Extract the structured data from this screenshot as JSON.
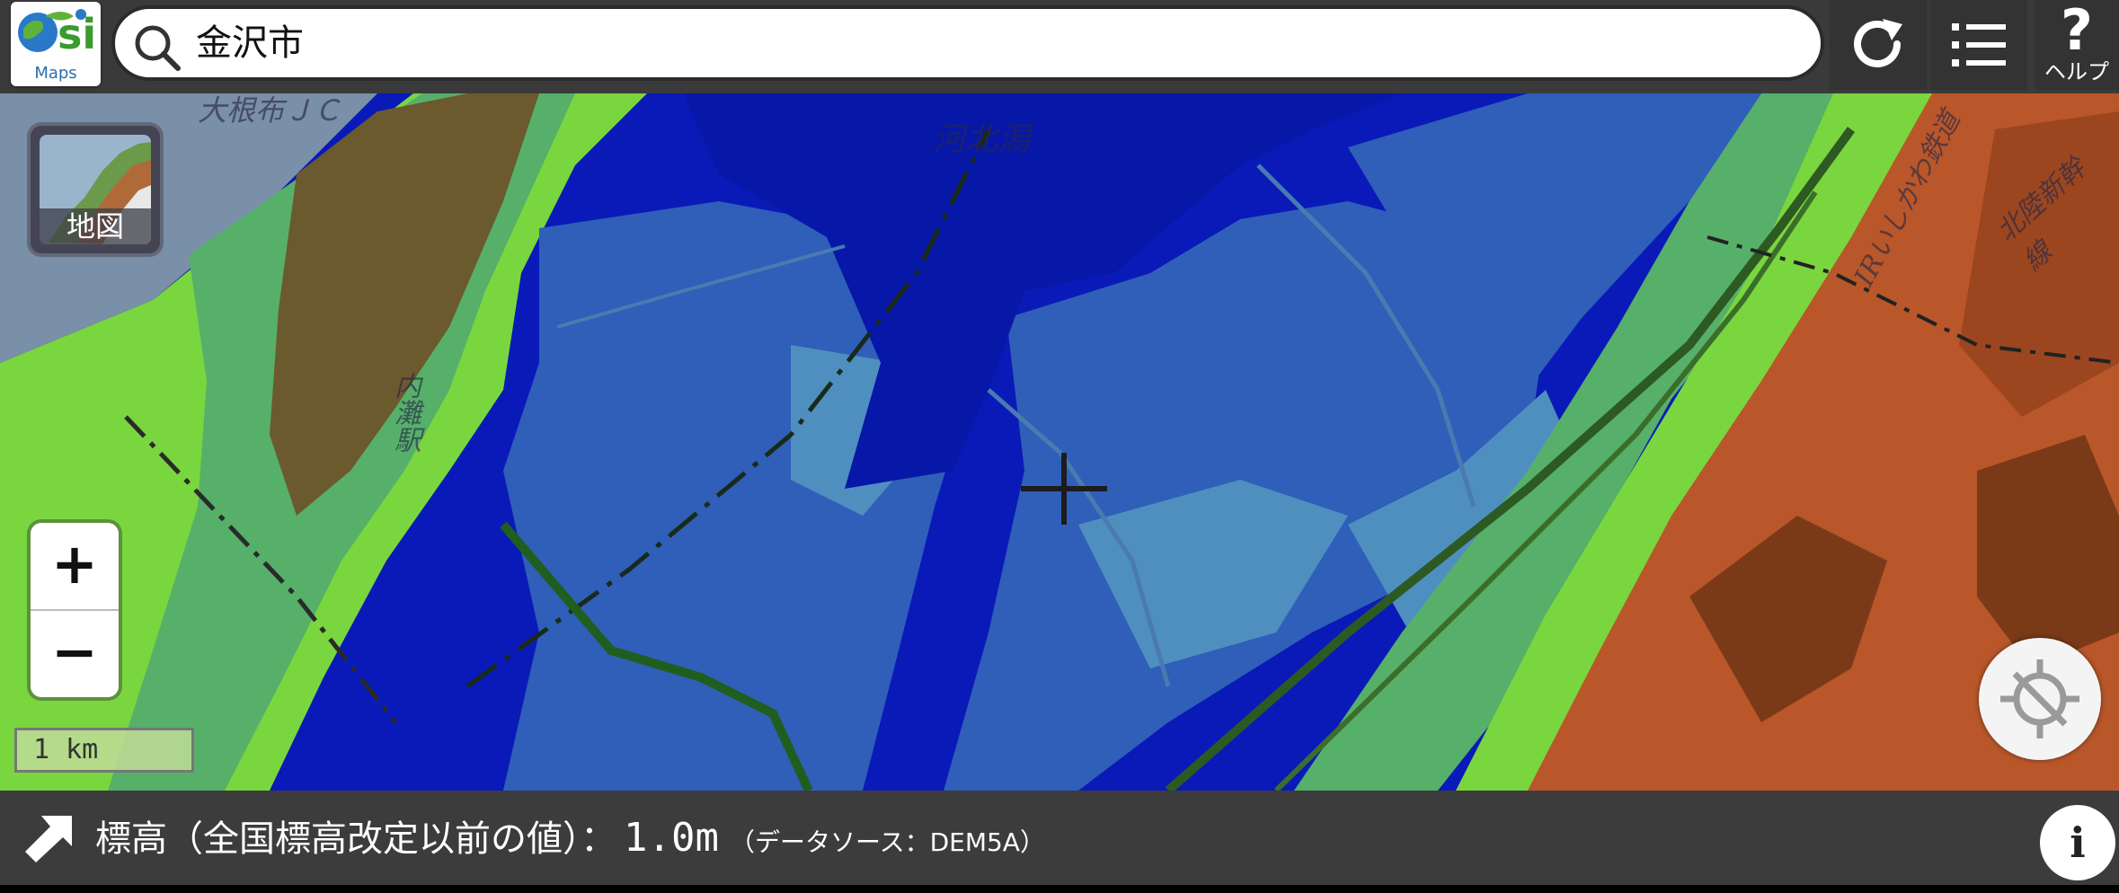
{
  "app": {
    "logo_label": "Maps"
  },
  "search": {
    "value": "金沢市"
  },
  "toolbar": {
    "refresh_icon": "refresh-icon",
    "menu_icon": "list-menu-icon",
    "help_symbol": "?",
    "help_label": "ヘルプ"
  },
  "map": {
    "labels": {
      "lagoon": "河北潟",
      "city_corner": "大根布ＪＣ",
      "station": "内灘駅",
      "railway": "IRいしかわ鉄道",
      "shinkansen": "北陸新幹線"
    },
    "colors": {
      "lowest": "#0a1ab8",
      "low": "#2f5fb8",
      "mid_low": "#4f8fc0",
      "lowland": "#56b06a",
      "plain": "#7ad63e",
      "hill": "#b9572a",
      "hill_dark": "#7a3a18"
    }
  },
  "layer_button": {
    "label": "地図"
  },
  "zoom": {
    "in_label": "+",
    "out_label": "−"
  },
  "scale": {
    "label": "1 km"
  },
  "elevation_bar": {
    "label": "標高（全国標高改定以前の値）：",
    "value": "1.0m",
    "source": "（データソース：DEM5A）",
    "info_label": "i"
  }
}
